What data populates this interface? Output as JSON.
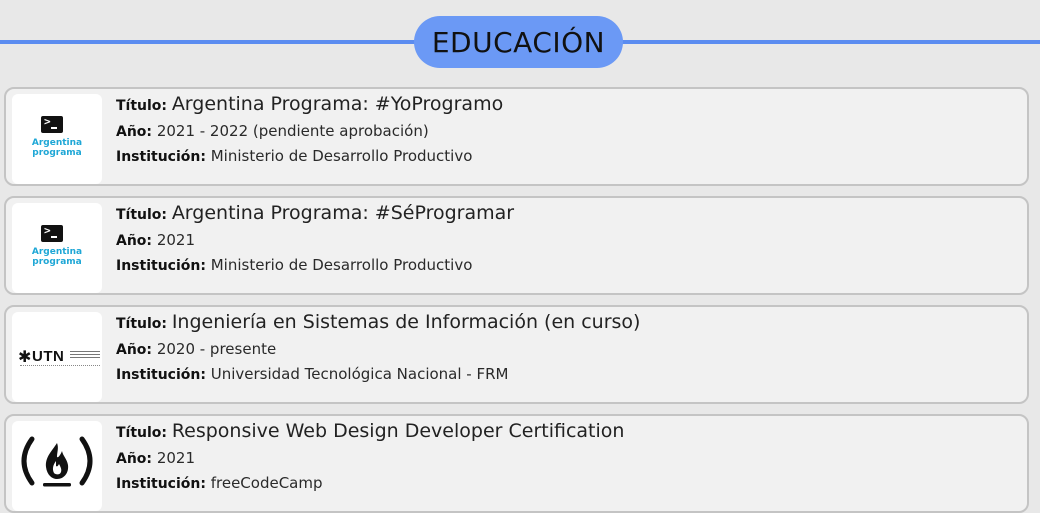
{
  "section": {
    "title": "EDUCACIÓN"
  },
  "labels": {
    "title": "Título:",
    "year": "Año:",
    "institution": "Institución:"
  },
  "education": [
    {
      "title": "Argentina Programa: #YoProgramo",
      "year": "2021 - 2022 (pendiente aprobación)",
      "institution": "Ministerio de Desarrollo Productivo",
      "logo_icon": "argentina-programa-logo",
      "logo_text_1": "Argentina",
      "logo_text_2": "programa"
    },
    {
      "title": "Argentina Programa: #SéProgramar",
      "year": "2021",
      "institution": "Ministerio de Desarrollo Productivo",
      "logo_icon": "argentina-programa-logo",
      "logo_text_1": "Argentina",
      "logo_text_2": "programa"
    },
    {
      "title": "Ingeniería en Sistemas de Información (en curso)",
      "year": "2020 - presente",
      "institution": "Universidad Tecnológica Nacional - FRM",
      "logo_icon": "utn-logo",
      "logo_text_1": "UTN"
    },
    {
      "title": "Responsive Web Design Developer Certification",
      "year": "2021",
      "institution": "freeCodeCamp",
      "logo_icon": "freecodecamp-logo"
    }
  ],
  "colors": {
    "accent": "#6b99f5",
    "line": "#5b8cf0",
    "card_border": "#c4c4c4",
    "card_bg": "#f1f1f1",
    "page_bg": "#e8e8e8",
    "argentina_programa_text": "#1fa7d6"
  }
}
